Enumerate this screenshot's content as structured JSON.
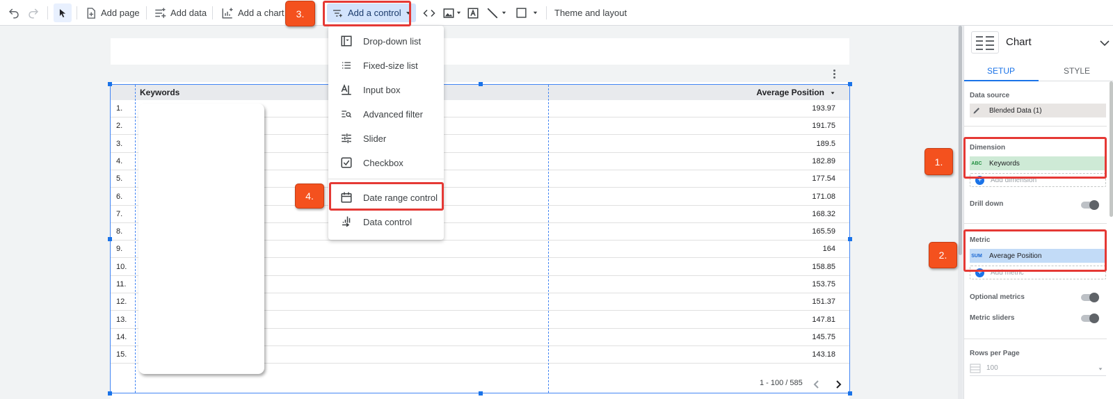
{
  "toolbar": {
    "add_page": "Add page",
    "add_data": "Add data",
    "add_chart": "Add a chart",
    "add_control": "Add a control",
    "theme_layout": "Theme and layout"
  },
  "menu": {
    "items": [
      {
        "label": "Drop-down list",
        "icon": "dropdown-list-icon"
      },
      {
        "label": "Fixed-size list",
        "icon": "fixed-list-icon"
      },
      {
        "label": "Input box",
        "icon": "input-box-icon"
      },
      {
        "label": "Advanced filter",
        "icon": "advanced-filter-icon"
      },
      {
        "label": "Slider",
        "icon": "slider-icon"
      },
      {
        "label": "Checkbox",
        "icon": "checkbox-icon"
      },
      {
        "label": "Date range control",
        "icon": "calendar-icon"
      },
      {
        "label": "Data control",
        "icon": "data-control-icon"
      }
    ]
  },
  "table": {
    "col_dimension": "Keywords",
    "col_metric": "Average Position",
    "rows": [
      {
        "idx": "1.",
        "value": "193.97"
      },
      {
        "idx": "2.",
        "value": "191.75"
      },
      {
        "idx": "3.",
        "value": "189.5"
      },
      {
        "idx": "4.",
        "value": "182.89"
      },
      {
        "idx": "5.",
        "value": "177.54"
      },
      {
        "idx": "6.",
        "value": "171.08"
      },
      {
        "idx": "7.",
        "value": "168.32"
      },
      {
        "idx": "8.",
        "value": "165.59"
      },
      {
        "idx": "9.",
        "value": "164"
      },
      {
        "idx": "10.",
        "value": "158.85"
      },
      {
        "idx": "11.",
        "value": "153.75"
      },
      {
        "idx": "12.",
        "value": "151.37"
      },
      {
        "idx": "13.",
        "value": "147.81"
      },
      {
        "idx": "14.",
        "value": "145.75"
      },
      {
        "idx": "15.",
        "value": "143.18"
      }
    ],
    "pagination": "1 - 100 / 585"
  },
  "panel": {
    "title": "Chart",
    "tab_setup": "SETUP",
    "tab_style": "STYLE",
    "data_source_label": "Data source",
    "data_source_value": "Blended Data (1)",
    "dimension_label": "Dimension",
    "dimension_prefix": "ABC",
    "dimension_value": "Keywords",
    "add_dimension": "Add dimension",
    "drill_down": "Drill down",
    "metric_label": "Metric",
    "metric_prefix": "SUM",
    "metric_value": "Average Position",
    "add_metric": "Add metric",
    "optional_metrics": "Optional metrics",
    "metric_sliders": "Metric sliders",
    "rows_per_page_label": "Rows per Page",
    "rows_per_page_value": "100"
  },
  "callouts": [
    "1.",
    "2.",
    "3.",
    "4."
  ],
  "colors": {
    "accent": "#1a73e8",
    "highlight": "#e53935",
    "badge": "#f4511e",
    "dimension_green": "#ceead6",
    "metric_blue": "#c2dbf7"
  }
}
